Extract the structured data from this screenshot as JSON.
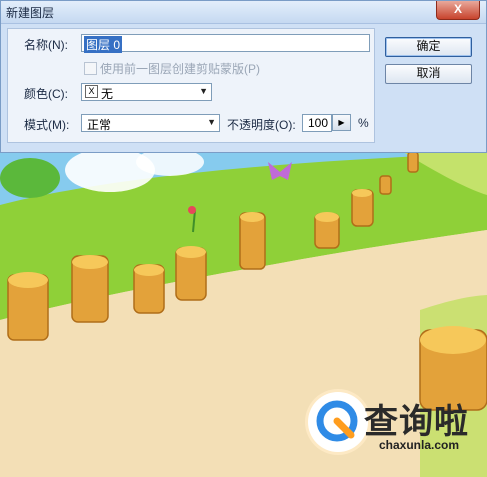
{
  "dialog": {
    "title": "新建图层",
    "close_label": "X",
    "name_label": "名称(N):",
    "name_value": "图层 0",
    "clip_label": "使用前一图层创建剪贴蒙版(P)",
    "color_label": "颜色(C):",
    "color_value": "无",
    "color_prefix": "X",
    "mode_label": "模式(M):",
    "mode_value": "正常",
    "opacity_label": "不透明度(O):",
    "opacity_value": "100",
    "opacity_unit": "%",
    "ok_label": "确定",
    "cancel_label": "取消"
  },
  "watermark": {
    "brand": "查询啦",
    "url": "chaxunla.com"
  },
  "colors": {
    "accent": "#3670c4",
    "arrow": "#e03b2e",
    "grass": "#8fcf3a",
    "sky": "#7ec6f2",
    "path": "#f2dcb4",
    "logo_blue": "#2f8be6",
    "logo_orange": "#ff9d1e"
  }
}
